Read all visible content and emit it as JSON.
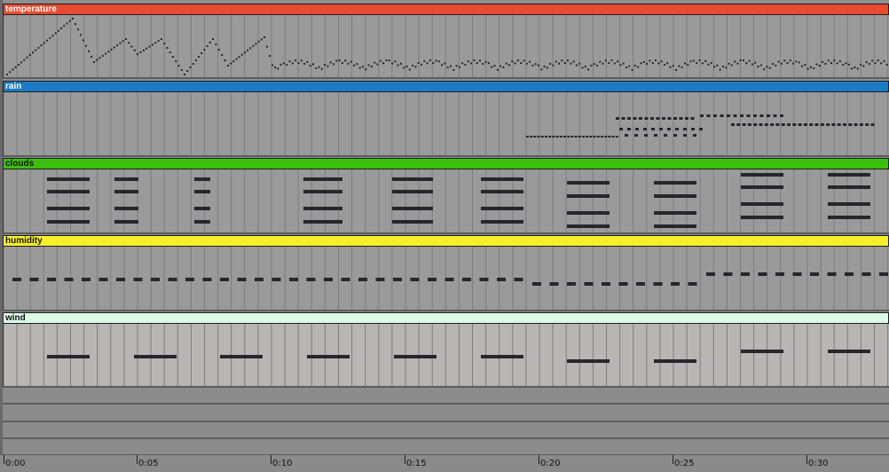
{
  "tracks": [
    {
      "id": "temperature",
      "name": "temperature",
      "color": "#e84a2f",
      "text_color": "#ffffff",
      "lane_bg": "#9a9a9a"
    },
    {
      "id": "rain",
      "name": "rain",
      "color": "#1a7ac4",
      "text_color": "#ffffff",
      "lane_bg": "#9a9a9a"
    },
    {
      "id": "clouds",
      "name": "clouds",
      "color": "#3cbf0c",
      "text_color": "#111111",
      "lane_bg": "#9a9a9a"
    },
    {
      "id": "humidity",
      "name": "humidity",
      "color": "#f7ef2a",
      "text_color": "#111111",
      "lane_bg": "#9a9a9a"
    },
    {
      "id": "wind",
      "name": "wind",
      "color": "#ddfbe9",
      "text_color": "#111111",
      "lane_bg": "#b8b5b5"
    }
  ],
  "ruler": {
    "labels": [
      "0:00",
      "0:05",
      "0:10",
      "0:15",
      "0:20",
      "0:25",
      "0:30"
    ]
  },
  "note_color": "#26262b",
  "grid_color": "#7d7d7d"
}
